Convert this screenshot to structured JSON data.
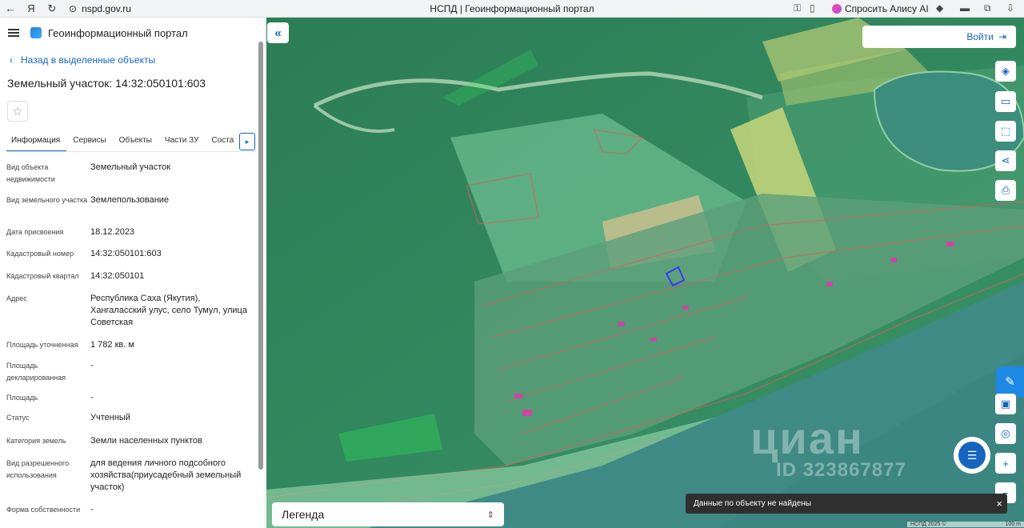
{
  "browser": {
    "url": "nspd.gov.ru",
    "tab_title": "НСПД | Геоинформационный портал",
    "alice_label": "Спросить Алису AI"
  },
  "sidebar": {
    "portal_title": "Геоинформационный портал",
    "back_label": "Назад в выделенные объекты",
    "object_title": "Земельный участок: 14:32:050101:603",
    "tabs": [
      "Информация",
      "Сервисы",
      "Объекты",
      "Части ЗУ",
      "Соста"
    ],
    "info": [
      {
        "label": "Вид объекта недвижимости",
        "value": "Земельный участок"
      },
      {
        "label": "Вид земельного участка",
        "value": "Землепользование"
      },
      {
        "label": "Дата присвоения",
        "value": "18.12.2023"
      },
      {
        "label": "Кадастровый номер",
        "value": "14:32:050101:603"
      },
      {
        "label": "Кадастровый квартал",
        "value": "14:32:050101"
      },
      {
        "label": "Адрес",
        "value": "Республика Саха (Якутия), Хангаласский улус, село Тумул, улица Советская"
      },
      {
        "label": "Площадь уточненная",
        "value": "1 782 кв. м"
      },
      {
        "label": "Площадь декларированная",
        "value": "-"
      },
      {
        "label": "Площадь",
        "value": "-"
      },
      {
        "label": "Статус",
        "value": "Учтенный"
      },
      {
        "label": "Категория земель",
        "value": "Земли населенных пунктов"
      },
      {
        "label": "Вид разрешенного использования",
        "value": "для ведения личного подсобного хозяйства(приусадебный земельный участок)"
      },
      {
        "label": "Форма собственности",
        "value": "-"
      }
    ]
  },
  "map": {
    "login_label": "Войти",
    "legend_label": "Легенда",
    "toast_text": "Данные по объекту не найдены",
    "watermark_logo": "циан",
    "watermark_id": "ID 323867877",
    "copyright": "НСПД 2025 ©",
    "scale": "100 m"
  },
  "colors": {
    "accent": "#1565c0",
    "map_forest": "#2f8a5d",
    "map_river": "#3f8a84",
    "parcel_border": "#e05a5a",
    "selected_parcel": "#3a3aff"
  }
}
